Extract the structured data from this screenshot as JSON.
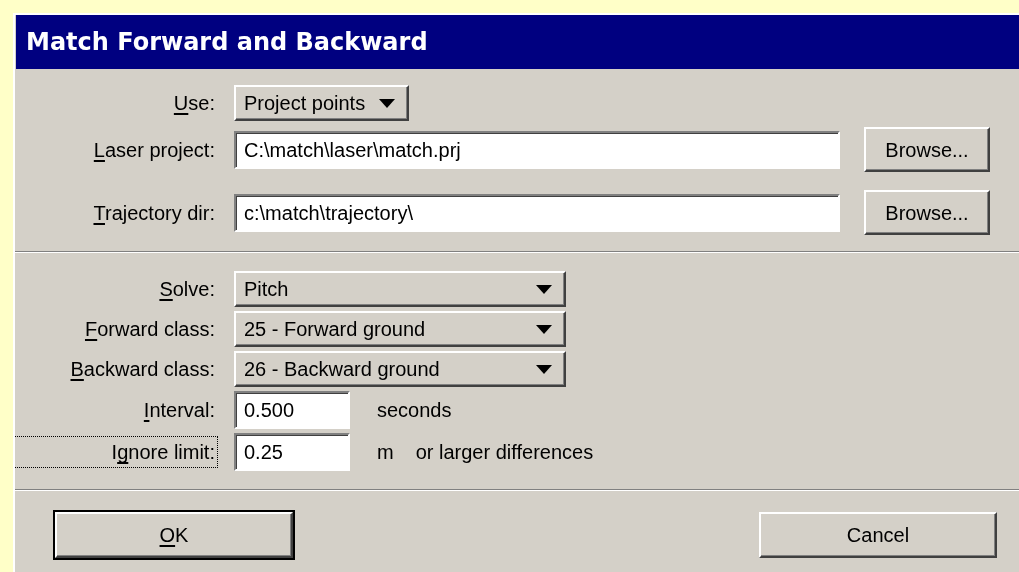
{
  "window": {
    "title": "Match Forward and Backward"
  },
  "source_rows": [
    {
      "kind": "dropdown",
      "label": [
        {
          "text": "U",
          "underlined": true
        },
        {
          "text": "se:",
          "underlined": false
        }
      ],
      "value": "Project points"
    },
    {
      "kind": "field",
      "label": [
        {
          "text": "L",
          "underlined": true
        },
        {
          "text": "aser project:",
          "underlined": false
        }
      ],
      "value": "C:\\match\\laser\\match.prj",
      "button": "Browse..."
    },
    {
      "kind": "field",
      "label": [
        {
          "text": "T",
          "underlined": true
        },
        {
          "text": "rajectory dir:",
          "underlined": false
        }
      ],
      "value": "c:\\match\\trajectory\\",
      "button": "Browse..."
    }
  ],
  "option_rows": [
    {
      "kind": "dropdown",
      "label": [
        {
          "text": "S",
          "underlined": true
        },
        {
          "text": "olve:",
          "underlined": false
        }
      ],
      "value": "Pitch"
    },
    {
      "kind": "dropdown",
      "label": [
        {
          "text": "F",
          "underlined": true
        },
        {
          "text": "orward class:",
          "underlined": false
        }
      ],
      "value": "25 - Forward ground"
    },
    {
      "kind": "dropdown",
      "label": [
        {
          "text": "B",
          "underlined": true
        },
        {
          "text": "ackward class:",
          "underlined": false
        }
      ],
      "value": "26 - Backward ground"
    },
    {
      "kind": "field",
      "label": [
        {
          "text": "I",
          "underlined": true
        },
        {
          "text": "nterval:",
          "underlined": false
        }
      ],
      "value": "0.500",
      "unit": "seconds",
      "focused": false
    },
    {
      "kind": "field",
      "label": [
        {
          "text": "I",
          "underlined": false
        },
        {
          "text": "g",
          "underlined": true
        },
        {
          "text": "nore limit:",
          "underlined": false
        }
      ],
      "value": "0.25",
      "unit": "m",
      "note": "or larger differences",
      "focused": true
    }
  ],
  "buttons": [
    {
      "label": [
        {
          "text": "O",
          "underlined": true
        },
        {
          "text": "K",
          "underlined": false
        }
      ],
      "default": true
    },
    {
      "label": [
        {
          "text": "Cancel",
          "underlined": false
        }
      ],
      "default": false
    }
  ]
}
